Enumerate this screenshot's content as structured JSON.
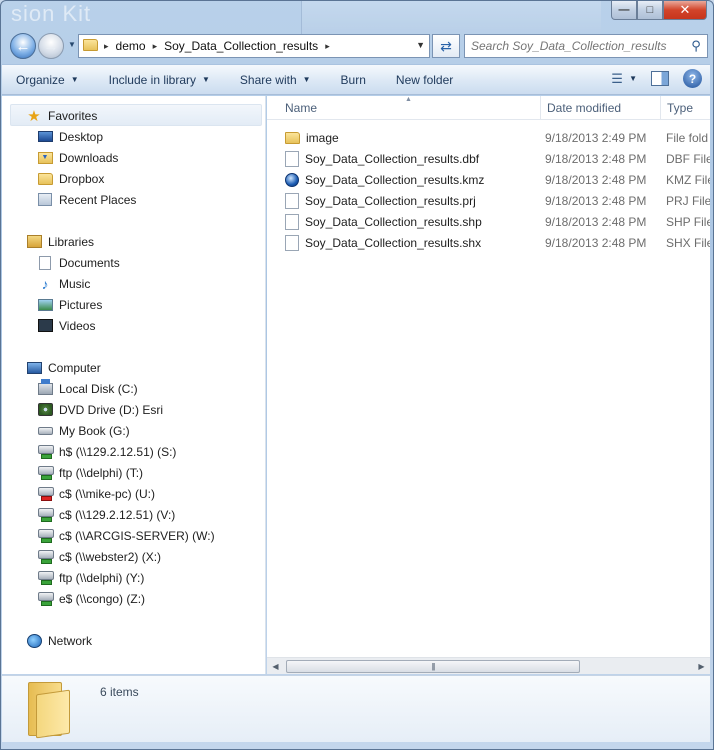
{
  "window": {
    "background_text": "sion Kit",
    "minimize_icon": "minimize-icon",
    "maximize_icon": "maximize-icon",
    "close_icon": "close-icon"
  },
  "address_bar": {
    "crumbs": [
      "demo",
      "Soy_Data_Collection_results"
    ],
    "search_placeholder": "Search Soy_Data_Collection_results"
  },
  "toolbar": {
    "organize": "Organize",
    "include_in_library": "Include in library",
    "share_with": "Share with",
    "burn": "Burn",
    "new_folder": "New folder"
  },
  "nav_pane": {
    "favorites": {
      "label": "Favorites",
      "items": [
        "Desktop",
        "Downloads",
        "Dropbox",
        "Recent Places"
      ]
    },
    "libraries": {
      "label": "Libraries",
      "items": [
        "Documents",
        "Music",
        "Pictures",
        "Videos"
      ]
    },
    "computer": {
      "label": "Computer",
      "items": [
        "Local Disk (C:)",
        "DVD Drive (D:) Esri",
        "My Book (G:)",
        "h$ (\\\\129.2.12.51) (S:)",
        "ftp (\\\\delphi) (T:)",
        "c$ (\\\\mike-pc) (U:)",
        "c$ (\\\\129.2.12.51) (V:)",
        "c$ (\\\\ARCGIS-SERVER) (W:)",
        "c$ (\\\\webster2) (X:)",
        "ftp (\\\\delphi) (Y:)",
        "e$ (\\\\congo) (Z:)"
      ]
    },
    "network": {
      "label": "Network"
    }
  },
  "columns": {
    "name": "Name",
    "date_modified": "Date modified",
    "type": "Type"
  },
  "files": [
    {
      "name": "image",
      "date": "9/18/2013 2:49 PM",
      "type": "File fold",
      "icon": "folder-icon"
    },
    {
      "name": "Soy_Data_Collection_results.dbf",
      "date": "9/18/2013 2:48 PM",
      "type": "DBF File",
      "icon": "file-icon"
    },
    {
      "name": "Soy_Data_Collection_results.kmz",
      "date": "9/18/2013 2:48 PM",
      "type": "KMZ File",
      "icon": "google-earth-icon"
    },
    {
      "name": "Soy_Data_Collection_results.prj",
      "date": "9/18/2013 2:48 PM",
      "type": "PRJ File",
      "icon": "file-icon"
    },
    {
      "name": "Soy_Data_Collection_results.shp",
      "date": "9/18/2013 2:48 PM",
      "type": "SHP File",
      "icon": "file-icon"
    },
    {
      "name": "Soy_Data_Collection_results.shx",
      "date": "9/18/2013 2:48 PM",
      "type": "SHX File",
      "icon": "file-icon"
    }
  ],
  "details": {
    "item_count": "6 items"
  }
}
